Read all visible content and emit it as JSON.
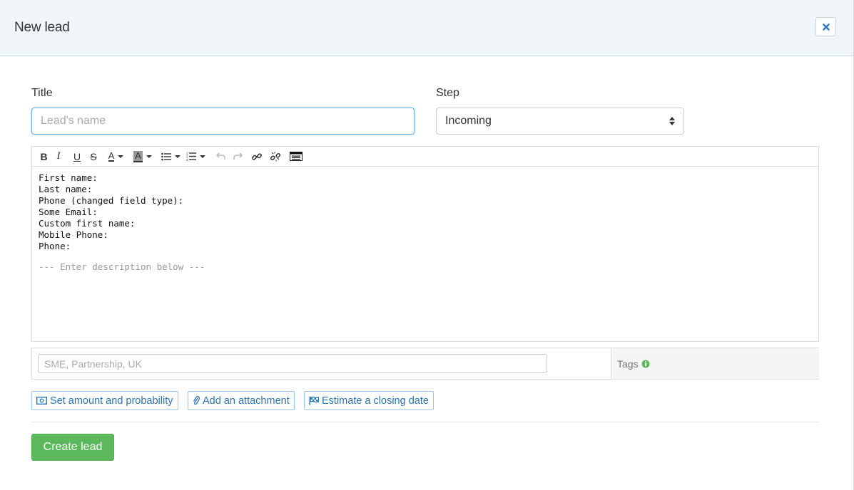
{
  "modal": {
    "title": "New lead",
    "close_icon": "close-icon"
  },
  "form": {
    "title_label": "Title",
    "title_placeholder": "Lead's name",
    "title_value": "",
    "step_label": "Step",
    "step_value": "Incoming"
  },
  "editor": {
    "toolbar_icons": [
      "bold-icon",
      "italic-icon",
      "underline-icon",
      "strikethrough-icon",
      "font-color-icon",
      "highlight-color-icon",
      "bullet-list-icon",
      "numbered-list-icon",
      "undo-icon",
      "redo-icon",
      "link-icon",
      "unlink-icon",
      "source-code-icon"
    ],
    "lines": [
      "First name:",
      "Last name:",
      "Phone (changed field type):",
      "Some Email:",
      "Custom first name:",
      "Mobile Phone:",
      "Phone:"
    ],
    "hint": "--- Enter description below ---"
  },
  "tags": {
    "placeholder": "SME, Partnership, UK",
    "value": "",
    "label": "Tags"
  },
  "actions": {
    "set_amount": "Set amount and probability",
    "add_attachment": "Add an attachment",
    "estimate_closing": "Estimate a closing date"
  },
  "submit_label": "Create lead",
  "colors": {
    "header_bg": "#f1f6fb",
    "link_blue": "#2a75b7",
    "success_green": "#5cb85c",
    "info_green": "#5cb85c"
  }
}
